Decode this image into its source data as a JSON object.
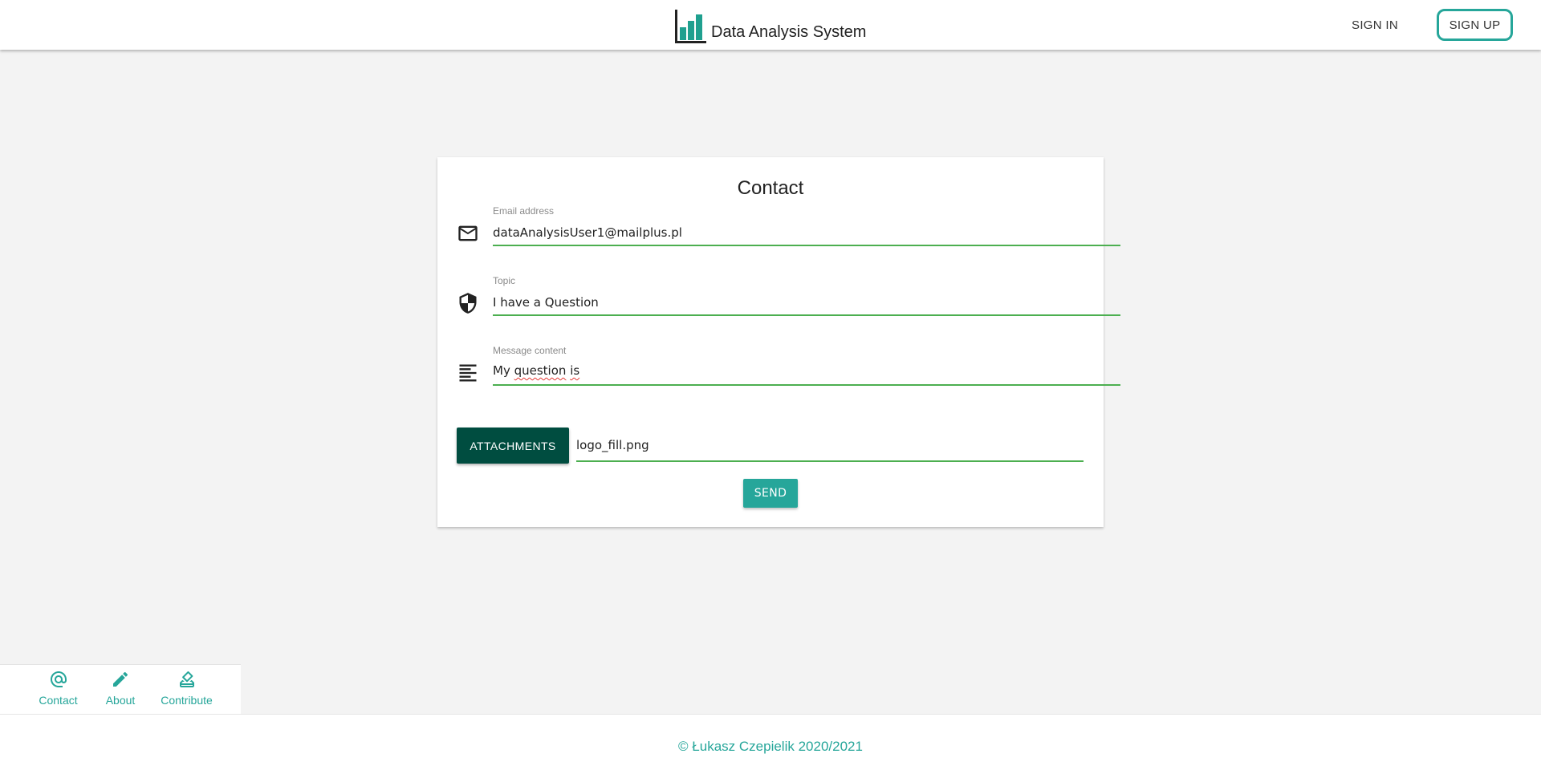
{
  "header": {
    "brand_title": "Data Analysis System",
    "signin_label": "SIGN IN",
    "signup_label": "SIGN UP",
    "logo_icon": "bar-chart-logo"
  },
  "contact": {
    "title": "Contact",
    "email": {
      "label": "Email address",
      "value": "dataAnalysisUser1@mailplus.pl",
      "icon": "mail-icon"
    },
    "topic": {
      "label": "Topic",
      "value": "I have a Question",
      "icon": "shield-icon"
    },
    "message": {
      "label": "Message content",
      "value_parts": [
        "My ",
        "question",
        " ",
        "is"
      ],
      "icon": "text-align-icon"
    },
    "attachments_label": "ATTACHMENTS",
    "attachment_file": "logo_fill.png",
    "send_label": "SEND"
  },
  "bottom_nav": {
    "items": [
      {
        "label": "Contact",
        "icon": "at-icon"
      },
      {
        "label": "About",
        "icon": "pencil-icon"
      },
      {
        "label": "Contribute",
        "icon": "contribute-icon"
      }
    ]
  },
  "footer": {
    "copyright": "© Łukasz Czepielik 2020/2021"
  },
  "colors": {
    "accent": "#26a69a",
    "dark_accent": "#004d40",
    "underline": "#4caf50",
    "logo_bar": "#1a9e8e"
  }
}
